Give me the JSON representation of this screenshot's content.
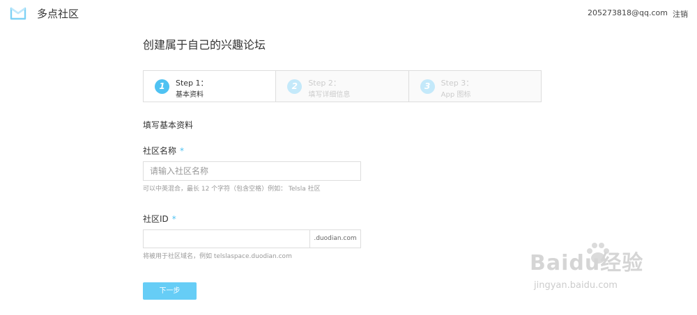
{
  "header": {
    "brand": "多点社区",
    "user_email": "205273818@qq.com",
    "logout_label": "注销"
  },
  "page": {
    "title": "创建属于自己的兴趣论坛"
  },
  "steps": [
    {
      "num": "1",
      "title": "Step 1：",
      "subtitle": "基本资料",
      "active": true
    },
    {
      "num": "2",
      "title": "Step 2：",
      "subtitle": "填写详细信息",
      "active": false
    },
    {
      "num": "3",
      "title": "Step 3：",
      "subtitle": "App 图标",
      "active": false
    }
  ],
  "form": {
    "section_title": "填写基本资料",
    "name_label": "社区名称",
    "name_required": "*",
    "name_placeholder": "请输入社区名称",
    "name_hint": "可以中英混合，最长 12 个字符（包含空格）例如： Telsla 社区",
    "id_label": "社区ID",
    "id_required": "*",
    "id_value": "",
    "id_suffix": ".duodian.com",
    "id_hint": "将被用于社区域名，例如 telslaspace.duodian.com",
    "next_label": "下一步"
  },
  "watermark": {
    "text": "Baidu经验",
    "url": "jingyan.baidu.com"
  },
  "colors": {
    "accent": "#4fc2f2",
    "button": "#66cdf6",
    "border": "#dddddd"
  }
}
